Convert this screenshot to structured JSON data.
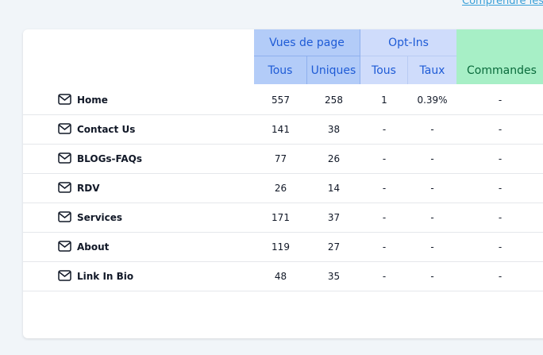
{
  "top_link": "Comprendre les",
  "header": {
    "vues_group": "Vues de page",
    "optins_group": "Opt-Ins",
    "sub": {
      "tous": "Tous",
      "uniques": "Uniques",
      "tous2": "Tous",
      "taux": "Taux",
      "commandes": "Commandes"
    }
  },
  "rows": [
    {
      "name": "Home",
      "tous": "557",
      "uniques": "258",
      "optin_tous": "1",
      "taux": "0.39%",
      "commandes": "-"
    },
    {
      "name": "Contact Us",
      "tous": "141",
      "uniques": "38",
      "optin_tous": "-",
      "taux": "-",
      "commandes": "-"
    },
    {
      "name": "BLOGs-FAQs",
      "tous": "77",
      "uniques": "26",
      "optin_tous": "-",
      "taux": "-",
      "commandes": "-"
    },
    {
      "name": "RDV",
      "tous": "26",
      "uniques": "14",
      "optin_tous": "-",
      "taux": "-",
      "commandes": "-"
    },
    {
      "name": "Services",
      "tous": "171",
      "uniques": "37",
      "optin_tous": "-",
      "taux": "-",
      "commandes": "-"
    },
    {
      "name": "About",
      "tous": "119",
      "uniques": "27",
      "optin_tous": "-",
      "taux": "-",
      "commandes": "-"
    },
    {
      "name": "Link In Bio",
      "tous": "48",
      "uniques": "35",
      "optin_tous": "-",
      "taux": "-",
      "commandes": "-"
    }
  ],
  "icons": {
    "row_icon": "mail-icon"
  }
}
